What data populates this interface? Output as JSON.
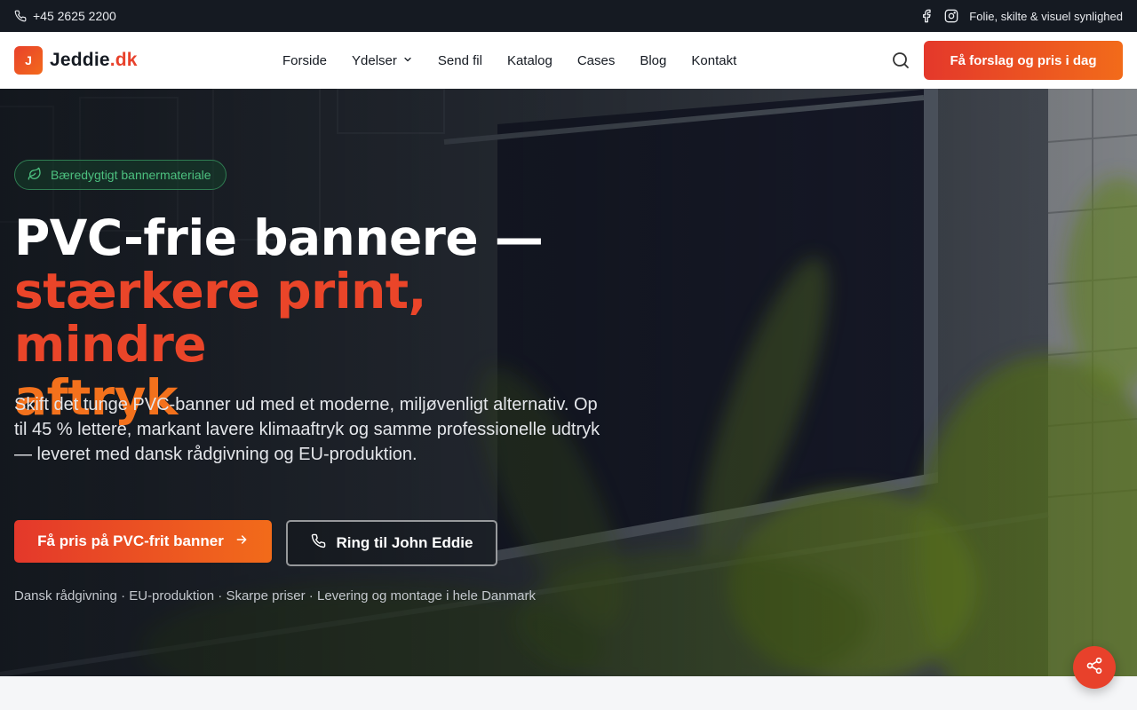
{
  "topbar": {
    "phone": "+45 2625 2200",
    "tagline": "Folie, skilte & visuel synlighed",
    "social": [
      "facebook-icon",
      "instagram-icon"
    ]
  },
  "header": {
    "logo_mark": "J",
    "logo_name": "Jeddie",
    "logo_tld": ".dk",
    "nav": [
      "Forside",
      "Ydelser",
      "Send fil",
      "Katalog",
      "Cases",
      "Blog",
      "Kontakt"
    ],
    "cta": "Få forslag og pris i dag"
  },
  "hero": {
    "badge": "Bæredygtigt bannermateriale",
    "title_line1": "PVC-frie bannere —",
    "title_line2": "stærkere print, mindre",
    "title_line3": "aftryk",
    "lead": "Skift det tunge PVC-banner ud med et moderne, miljøvenligt alternativ. Op til 45 % lettere, markant lavere klimaaftryk og samme professionelle udtryk — leveret med dansk rådgivning og EU-produktion.",
    "primary_cta": "Få pris på PVC-frit banner",
    "secondary_cta": "Ring til John Eddie",
    "trust_line": "Dansk rådgivning · EU-produktion · Skarpe priser · Levering og montage i hele Danmark"
  },
  "colors": {
    "accent_red": "#e8412b",
    "accent_orange": "#f26b1a",
    "dark": "#151a22",
    "badge_green": "#4cc07f"
  }
}
